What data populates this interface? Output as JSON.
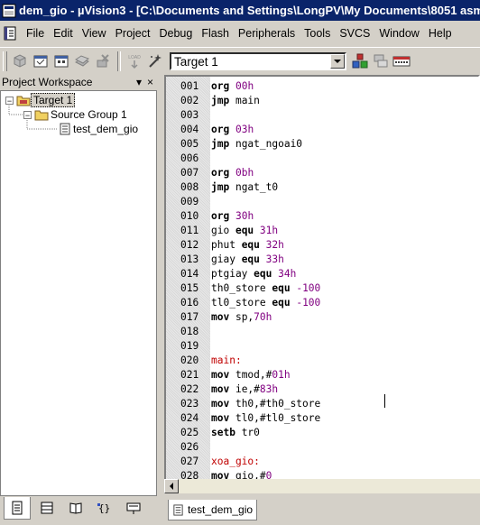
{
  "window": {
    "title": "dem_gio  - µVision3 - [C:\\Documents and Settings\\LongPV\\My Documents\\8051 asm"
  },
  "menu": [
    "File",
    "Edit",
    "View",
    "Project",
    "Debug",
    "Flash",
    "Peripherals",
    "Tools",
    "SVCS",
    "Window",
    "Help"
  ],
  "toolbar": {
    "target_value": "Target 1",
    "load_label": "LOAD"
  },
  "workspace": {
    "title": "Project Workspace",
    "pin": "▾",
    "close": "×",
    "tree": {
      "target": "Target 1",
      "group": "Source Group 1",
      "file": "test_dem_gio"
    }
  },
  "editor": {
    "lines": [
      {
        "n": "001",
        "kw": "org",
        "rest": " ",
        "num": "00h"
      },
      {
        "n": "002",
        "kw": "jmp",
        "rest": " main",
        "num": ""
      },
      {
        "n": "003",
        "kw": "",
        "rest": "",
        "num": ""
      },
      {
        "n": "004",
        "kw": "org",
        "rest": " ",
        "num": "03h"
      },
      {
        "n": "005",
        "kw": "jmp",
        "rest": " ngat_ngoai0",
        "num": ""
      },
      {
        "n": "006",
        "kw": "",
        "rest": "",
        "num": ""
      },
      {
        "n": "007",
        "kw": "org",
        "rest": " ",
        "num": "0bh"
      },
      {
        "n": "008",
        "kw": "jmp",
        "rest": " ngat_t0",
        "num": ""
      },
      {
        "n": "009",
        "kw": "",
        "rest": "",
        "num": ""
      },
      {
        "n": "010",
        "kw": "org",
        "rest": " ",
        "num": "30h"
      },
      {
        "n": "011",
        "pre": "gio ",
        "kw": "equ",
        "rest": " ",
        "num": "31h"
      },
      {
        "n": "012",
        "pre": "phut ",
        "kw": "equ",
        "rest": " ",
        "num": "32h"
      },
      {
        "n": "013",
        "pre": "giay ",
        "kw": "equ",
        "rest": " ",
        "num": "33h"
      },
      {
        "n": "014",
        "pre": "ptgiay ",
        "kw": "equ",
        "rest": " ",
        "num": "34h"
      },
      {
        "n": "015",
        "pre": "th0_store ",
        "kw": "equ",
        "rest": " ",
        "num": "-100"
      },
      {
        "n": "016",
        "pre": "tl0_store ",
        "kw": "equ",
        "rest": " ",
        "num": "-100"
      },
      {
        "n": "017",
        "kw": "mov",
        "rest": " sp,",
        "num": "70h"
      },
      {
        "n": "018",
        "kw": "",
        "rest": "",
        "num": ""
      },
      {
        "n": "019",
        "kw": "",
        "rest": "",
        "num": ""
      },
      {
        "n": "020",
        "label": "main:"
      },
      {
        "n": "021",
        "kw": "mov",
        "rest": " tmod,#",
        "num": "01h"
      },
      {
        "n": "022",
        "kw": "mov",
        "rest": " ie,#",
        "num": "83h"
      },
      {
        "n": "023",
        "kw": "mov",
        "rest": " th0,#th0_store",
        "num": ""
      },
      {
        "n": "024",
        "kw": "mov",
        "rest": " tl0,#tl0_store",
        "num": ""
      },
      {
        "n": "025",
        "kw": "setb",
        "rest": " tr0",
        "num": ""
      },
      {
        "n": "026",
        "kw": "",
        "rest": "",
        "num": ""
      },
      {
        "n": "027",
        "label": "xoa_gio:"
      },
      {
        "n": "028",
        "kw": "mov",
        "rest": " gio,#",
        "num": "0"
      }
    ],
    "tab_label": "test_dem_gio"
  }
}
